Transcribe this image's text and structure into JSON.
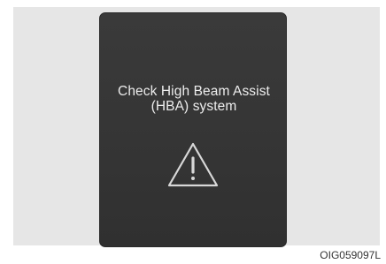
{
  "display": {
    "message_line1": "Check High Beam Assist",
    "message_line2": "(HBA) system",
    "icon": "warning-triangle-icon",
    "background_color": "#353535",
    "text_color": "#ededed"
  },
  "figure": {
    "code": "OIG059097L"
  }
}
